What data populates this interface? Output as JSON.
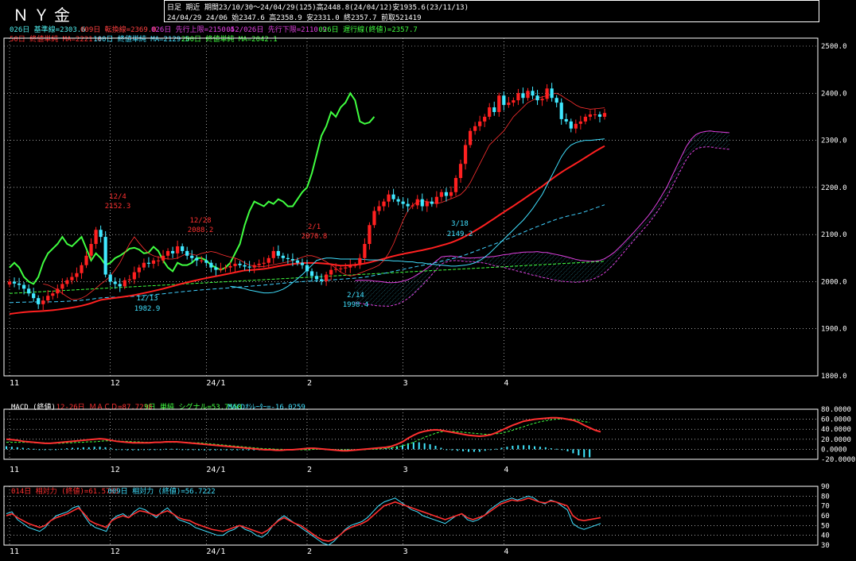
{
  "header": {
    "title": "ＮＹ金",
    "line1": "日足 期近 期間23/10/30～24/04/29(125)高2448.8(24/04/12)安1935.6(23/11/13)",
    "line2": "24/04/29 24/06 始2347.6 高2358.9 安2331.0 終2357.7 前取521419"
  },
  "legend_main": [
    {
      "text": "026日 基準線=2303.6",
      "color": "#4ff0f0"
    },
    {
      "text": "009日 転換線=2369.0",
      "color": "#ff4040"
    },
    {
      "text": "026日 先行上限=2150.4",
      "color": "#e040e0"
    },
    {
      "text": "052/026日 先行下限=2110.9",
      "color": "#e040e0"
    },
    {
      "text": "026日 遅行線(終値)=2357.7",
      "color": "#40ff40"
    },
    {
      "text": "50日 終値単純 MA=2221.4",
      "color": "#ff3030"
    },
    {
      "text": "100日 終値単純 MA=2129.5",
      "color": "#40e0ff"
    },
    {
      "text": "200日 終値単純 MA=2042.1",
      "color": "#40ff40"
    }
  ],
  "legend_macd": [
    {
      "text": "MACD (終値)",
      "color": "#ffffff"
    },
    {
      "text": "12-26日 ＭＡＣＤ=87.7238",
      "color": "#ff3030"
    },
    {
      "text": "9日 単純 シグナル=53.7558",
      "color": "#40ff40"
    },
    {
      "text": "MACDｵｼﾚｰﾀｰ=-16.0259",
      "color": "#40e0ff"
    }
  ],
  "legend_rsi": [
    {
      "text": "014日 相対力 (終値)=61.5785",
      "color": "#ff3030"
    },
    {
      "text": "009日 相対力 (終値)=56.7222",
      "color": "#40e0ff"
    }
  ],
  "colors": {
    "up": "#ff2020",
    "down": "#40e8ff",
    "kijun": "#40e0ff",
    "tenkan": "#ff3030",
    "chikou": "#40ff40",
    "cloud_up": "#e040e0",
    "cloud_dn": "#e040e0",
    "ma50": "#ff2020",
    "ma100": "#40d0ff",
    "ma200": "#40ff40",
    "grid": "#ffffff"
  },
  "chart_data": [
    {
      "type": "candlestick",
      "title": "ＮＹ金 日足 期近",
      "y_ticks": [
        "2500.0",
        "2400.0",
        "2300.0",
        "2200.0",
        "2100.0",
        "2000.0",
        "1900.0",
        "1800.0"
      ],
      "ylim": [
        1800,
        2500
      ],
      "x_ticks": [
        "11",
        "12",
        "24/1",
        "2",
        "3",
        "4"
      ],
      "annotations": [
        {
          "date": "12/4",
          "value": "2152.3"
        },
        {
          "date": "12/13",
          "value": "1982.9"
        },
        {
          "date": "12/28",
          "value": "2088.2"
        },
        {
          "date": "2/1",
          "value": "2070.8"
        },
        {
          "date": "2/14",
          "value": "1998.4"
        },
        {
          "date": "3/18",
          "value": "2149.2"
        }
      ],
      "close": [
        2000,
        1996,
        1993,
        1985,
        1975,
        1965,
        1952,
        1960,
        1970,
        1975,
        1985,
        1995,
        2003,
        2010,
        2018,
        2035,
        2055,
        2080,
        2110,
        2095,
        2015,
        2000,
        1995,
        1990,
        2003,
        2005,
        2020,
        2030,
        2040,
        2038,
        2045,
        2045,
        2055,
        2065,
        2060,
        2075,
        2065,
        2055,
        2050,
        2045,
        2045,
        2040,
        2030,
        2025,
        2028,
        2030,
        2033,
        2038,
        2035,
        2032,
        2030,
        2035,
        2038,
        2040,
        2050,
        2065,
        2055,
        2050,
        2048,
        2045,
        2040,
        2035,
        2022,
        2012,
        2005,
        2001,
        2015,
        2025,
        2027,
        2028,
        2030,
        2035,
        2035,
        2050,
        2080,
        2120,
        2150,
        2160,
        2170,
        2185,
        2175,
        2170,
        2165,
        2160,
        2162,
        2175,
        2160,
        2170,
        2165,
        2180,
        2190,
        2182,
        2190,
        2220,
        2250,
        2290,
        2320,
        2330,
        2340,
        2350,
        2370,
        2360,
        2395,
        2375,
        2380,
        2385,
        2400,
        2390,
        2405,
        2395,
        2385,
        2388,
        2410,
        2390,
        2380,
        2345,
        2340,
        2325,
        2335,
        2340,
        2350,
        2355,
        2355,
        2350,
        2358
      ],
      "tenkan": [
        1995,
        1993,
        1988,
        1982,
        1975,
        1968,
        1962,
        1962,
        1965,
        1970,
        1978,
        1986,
        1995,
        2002,
        2012,
        2025,
        2040,
        2060,
        2080,
        2095,
        2082,
        2070,
        2060,
        2055,
        2052,
        2050,
        2048,
        2048,
        2050,
        2055,
        2060,
        2058,
        2056,
        2060,
        2062,
        2064,
        2062,
        2058,
        2055,
        2052,
        2050,
        2046,
        2040,
        2035,
        2033,
        2032,
        2032,
        2034,
        2036,
        2038,
        2040,
        2042,
        2045,
        2048,
        2052,
        2055,
        2055,
        2052,
        2048,
        2042,
        2036,
        2028,
        2020,
        2015,
        2012,
        2014,
        2018,
        2022,
        2026,
        2030,
        2035,
        2045,
        2060,
        2080,
        2105,
        2130,
        2150,
        2162,
        2170,
        2172,
        2170,
        2168,
        2166,
        2168,
        2172,
        2176,
        2180,
        2185,
        2195,
        2210,
        2230,
        2250,
        2270,
        2290,
        2300,
        2310,
        2320,
        2335,
        2350,
        2360,
        2370,
        2380,
        2385,
        2390,
        2392,
        2395,
        2398,
        2400,
        2395,
        2388,
        2382,
        2375,
        2370,
        2368,
        2366,
        2367,
        2368,
        2369
      ],
      "kijun": [
        1990,
        1989,
        1987,
        1985,
        1982,
        1980,
        1978,
        1976,
        1976,
        1977,
        1980,
        1984,
        1990,
        1998,
        2006,
        2015,
        2025,
        2035,
        2045,
        2048,
        2050,
        2050,
        2049,
        2048,
        2048,
        2048,
        2048,
        2048,
        2047,
        2046,
        2046,
        2046,
        2045,
        2045,
        2044,
        2044,
        2043,
        2042,
        2042,
        2040,
        2040,
        2038,
        2037,
        2036,
        2035,
        2034,
        2033,
        2033,
        2034,
        2035,
        2037,
        2040,
        2045,
        2052,
        2060,
        2070,
        2080,
        2090,
        2100,
        2110,
        2120,
        2130,
        2142,
        2155,
        2170,
        2185,
        2205,
        2225,
        2245,
        2265,
        2280,
        2290,
        2295,
        2298,
        2300,
        2300,
        2301,
        2302,
        2303
      ],
      "chikou": [
        2030,
        2040,
        2030,
        2010,
        2000,
        1995,
        2010,
        2040,
        2060,
        2070,
        2080,
        2095,
        2080,
        2075,
        2085,
        2095,
        2070,
        2045,
        2060,
        2050,
        2035,
        2040,
        2050,
        2055,
        2062,
        2070,
        2072,
        2068,
        2060,
        2062,
        2074,
        2065,
        2045,
        2030,
        2022,
        2040,
        2035,
        2035,
        2040,
        2050,
        2050,
        2045,
        2035,
        2030,
        2025,
        2030,
        2040,
        2060,
        2080,
        2120,
        2150,
        2170,
        2165,
        2160,
        2170,
        2165,
        2175,
        2170,
        2160,
        2160,
        2175,
        2190,
        2200,
        2230,
        2270,
        2310,
        2330,
        2360,
        2350,
        2370,
        2380,
        2400,
        2385,
        2340,
        2335,
        2338,
        2350
      ]
    },
    {
      "type": "line",
      "title": "MACD (終値)",
      "y_ticks": [
        "80.0000",
        "60.0000",
        "40.0000",
        "20.0000",
        "0.0000",
        "-20.0000"
      ],
      "ylim": [
        -20,
        80
      ],
      "macd": [
        20,
        19,
        18,
        16,
        15,
        14,
        13,
        12,
        12,
        13,
        14,
        15,
        16,
        17,
        18,
        19,
        20,
        21,
        20,
        18,
        16,
        15,
        14,
        13,
        13,
        13,
        13,
        14,
        14,
        15,
        15,
        15,
        14,
        13,
        12,
        11,
        10,
        9,
        8,
        7,
        6,
        5,
        4,
        3,
        2,
        1,
        0,
        -1,
        -1,
        -2,
        -2,
        -1,
        -1,
        0,
        1,
        2,
        2,
        1,
        0,
        -1,
        -2,
        -3,
        -3,
        -2,
        -1,
        0,
        1,
        2,
        3,
        4,
        6,
        10,
        15,
        22,
        28,
        33,
        36,
        38,
        39,
        38,
        36,
        34,
        32,
        30,
        28,
        27,
        26,
        27,
        29,
        33,
        38,
        43,
        48,
        52,
        56,
        58,
        60,
        61,
        62,
        63,
        63,
        62,
        60,
        58,
        54,
        48,
        43,
        38,
        35
      ],
      "signal": [
        14,
        14,
        14,
        14,
        14,
        13,
        13,
        13,
        12,
        12,
        12,
        13,
        13,
        14,
        14,
        15,
        15,
        16,
        17,
        17,
        17,
        16,
        16,
        15,
        15,
        14,
        14,
        14,
        14,
        14,
        14,
        14,
        14,
        14,
        13,
        13,
        12,
        11,
        10,
        9,
        8,
        7,
        6,
        5,
        4,
        3,
        2,
        1,
        1,
        0,
        0,
        -1,
        -1,
        -1,
        -1,
        -1,
        0,
        0,
        0,
        0,
        -1,
        -1,
        -1,
        -1,
        -1,
        -1,
        0,
        0,
        1,
        2,
        3,
        4,
        7,
        10,
        14,
        19,
        24,
        28,
        32,
        35,
        36,
        36,
        35,
        34,
        33,
        32,
        31,
        30,
        30,
        31,
        32,
        35,
        38,
        42,
        45,
        49,
        52,
        55,
        57,
        59,
        60,
        61,
        61,
        60,
        58,
        55,
        54
      ],
      "osc": [
        6,
        5,
        4,
        3,
        2,
        1,
        0,
        -1,
        -1,
        0,
        1,
        2,
        3,
        3,
        4,
        4,
        5,
        5,
        4,
        2,
        0,
        -1,
        -2,
        -2,
        -2,
        -1,
        -1,
        0,
        0,
        1,
        1,
        1,
        0,
        -1,
        -1,
        -2,
        -2,
        -2,
        -2,
        -2,
        -2,
        -2,
        -2,
        -2,
        -2,
        -2,
        -2,
        -2,
        -2,
        -2,
        -2,
        0,
        0,
        1,
        2,
        3,
        2,
        1,
        0,
        -1,
        -1,
        -2,
        -2,
        -1,
        0,
        1,
        1,
        2,
        2,
        2,
        3,
        6,
        8,
        12,
        14,
        14,
        12,
        10,
        7,
        3,
        0,
        -2,
        -3,
        -4,
        -5,
        -5,
        -5,
        -3,
        -1,
        1,
        3,
        5,
        7,
        8,
        8,
        8,
        6,
        5,
        4,
        2,
        1,
        0,
        -4,
        -8,
        -12,
        -16,
        -16
      ]
    },
    {
      "type": "line",
      "title": "相対力",
      "y_ticks": [
        "90",
        "80",
        "70",
        "60",
        "50",
        "40",
        "30"
      ],
      "ylim": [
        30,
        90
      ],
      "rsi14": [
        60,
        62,
        58,
        55,
        52,
        50,
        48,
        50,
        55,
        58,
        60,
        62,
        65,
        68,
        62,
        55,
        52,
        50,
        48,
        55,
        58,
        60,
        58,
        62,
        65,
        64,
        62,
        60,
        63,
        65,
        62,
        58,
        56,
        55,
        52,
        50,
        48,
        46,
        45,
        44,
        46,
        48,
        50,
        48,
        46,
        44,
        42,
        45,
        50,
        55,
        58,
        55,
        52,
        50,
        46,
        42,
        38,
        35,
        34,
        36,
        40,
        45,
        48,
        50,
        52,
        55,
        60,
        65,
        70,
        72,
        74,
        72,
        70,
        68,
        66,
        64,
        62,
        60,
        58,
        56,
        58,
        60,
        62,
        58,
        56,
        58,
        60,
        64,
        68,
        72,
        74,
        76,
        75,
        76,
        78,
        76,
        74,
        73,
        75,
        74,
        72,
        70,
        60,
        56,
        55,
        56,
        57,
        58
      ],
      "rsi9": [
        62,
        64,
        56,
        52,
        48,
        46,
        44,
        48,
        55,
        60,
        62,
        64,
        68,
        70,
        60,
        52,
        48,
        46,
        44,
        56,
        60,
        62,
        58,
        64,
        68,
        66,
        62,
        58,
        64,
        68,
        62,
        56,
        54,
        52,
        48,
        46,
        44,
        42,
        40,
        40,
        44,
        46,
        50,
        46,
        44,
        40,
        38,
        42,
        50,
        56,
        60,
        56,
        52,
        48,
        44,
        40,
        36,
        32,
        30,
        34,
        40,
        46,
        50,
        52,
        54,
        58,
        64,
        70,
        74,
        76,
        78,
        74,
        70,
        66,
        64,
        60,
        58,
        56,
        54,
        52,
        56,
        60,
        62,
        56,
        54,
        56,
        60,
        66,
        70,
        74,
        76,
        78,
        76,
        78,
        80,
        78,
        74,
        72,
        76,
        74,
        70,
        66,
        52,
        48,
        46,
        48,
        50,
        52
      ]
    }
  ]
}
